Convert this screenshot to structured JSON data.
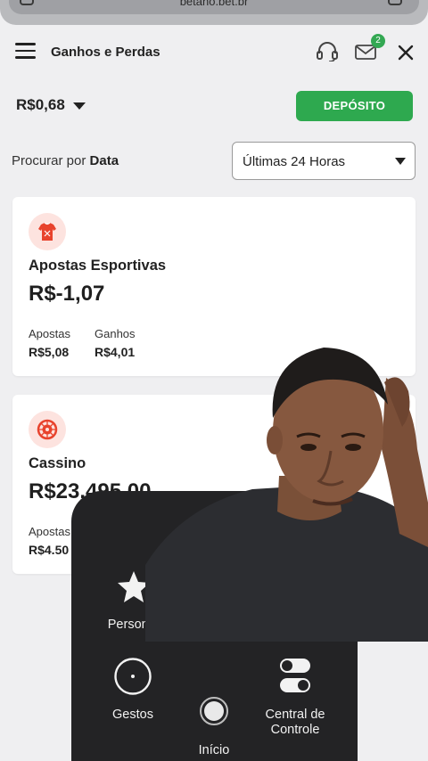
{
  "browser": {
    "url": "betano.bet.br"
  },
  "header": {
    "title": "Ganhos e Perdas",
    "notification_count": "2"
  },
  "balance": {
    "amount": "R$0,68",
    "deposit_label": "DEPÓSITO"
  },
  "filter": {
    "label_prefix": "Procurar por ",
    "label_bold": "Data",
    "selected": "Últimas 24 Horas"
  },
  "cards": [
    {
      "title": "Apostas Esportivas",
      "amount": "R$-1,07",
      "bets_label": "Apostas",
      "bets_value": "R$5,08",
      "wins_label": "Ganhos",
      "wins_value": "R$4,01",
      "icon": "jersey-icon"
    },
    {
      "title": "Cassino",
      "amount": "R$23.495,00",
      "bets_label": "Apostas",
      "bets_value": "R$4.50",
      "icon": "roulette-icon"
    }
  ],
  "assistive_touch": {
    "custom_label": "Personali",
    "gestures_label": "Gestos",
    "home_label": "Início",
    "control_center_label_1": "Central de",
    "control_center_label_2": "Controle"
  },
  "colors": {
    "accent_green": "#2ea94f",
    "background": "#efeff1",
    "menu_dark": "#232325"
  }
}
